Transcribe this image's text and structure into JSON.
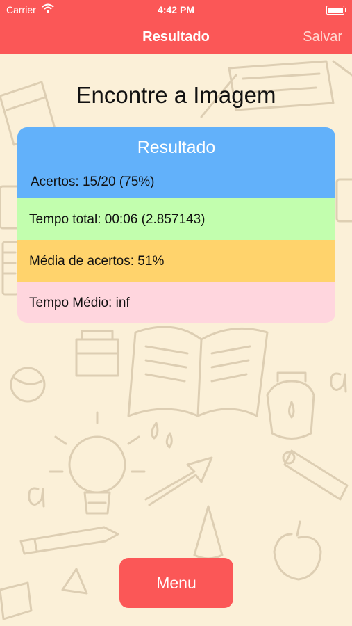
{
  "status_bar": {
    "carrier": "Carrier",
    "time": "4:42 PM"
  },
  "nav": {
    "title": "Resultado",
    "save_label": "Salvar"
  },
  "screen_title": "Encontre a Imagem",
  "result": {
    "title": "Resultado",
    "rows": [
      "Acertos: 15/20 (75%)",
      "Tempo total: 00:06 (2.857143)",
      "Média de acertos: 51%",
      "Tempo Médio: inf"
    ]
  },
  "menu_button": "Menu",
  "colors": {
    "nav_bg": "#fb5757",
    "background": "#fbf0d8",
    "header_blue": "#62b1fa",
    "row_green": "#c2feae",
    "row_yellow": "#ffd36c",
    "row_pink": "#ffd6de",
    "menu_bg": "#fb5757"
  }
}
